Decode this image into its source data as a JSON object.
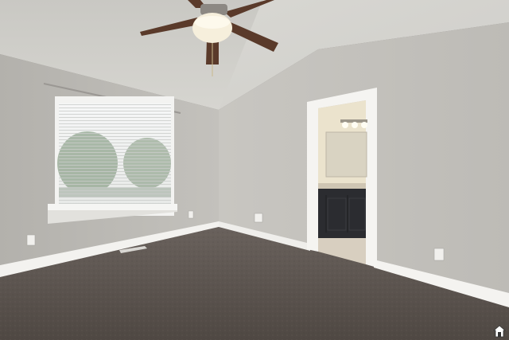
{
  "scene": {
    "subject": "empty-bedroom-photo",
    "colors": {
      "ceiling": "#d2d1cc",
      "wall_left": "#bcbab5",
      "wall_right": "#c6c4bf",
      "trim": "#f4f3f0",
      "carpet": "#5a524d",
      "cabinet": "#2b2c30",
      "bath_wall": "#ebe3cd",
      "fan_blade": "#5a3a2a"
    }
  },
  "watermark": {
    "icon": "house-logo-icon"
  }
}
